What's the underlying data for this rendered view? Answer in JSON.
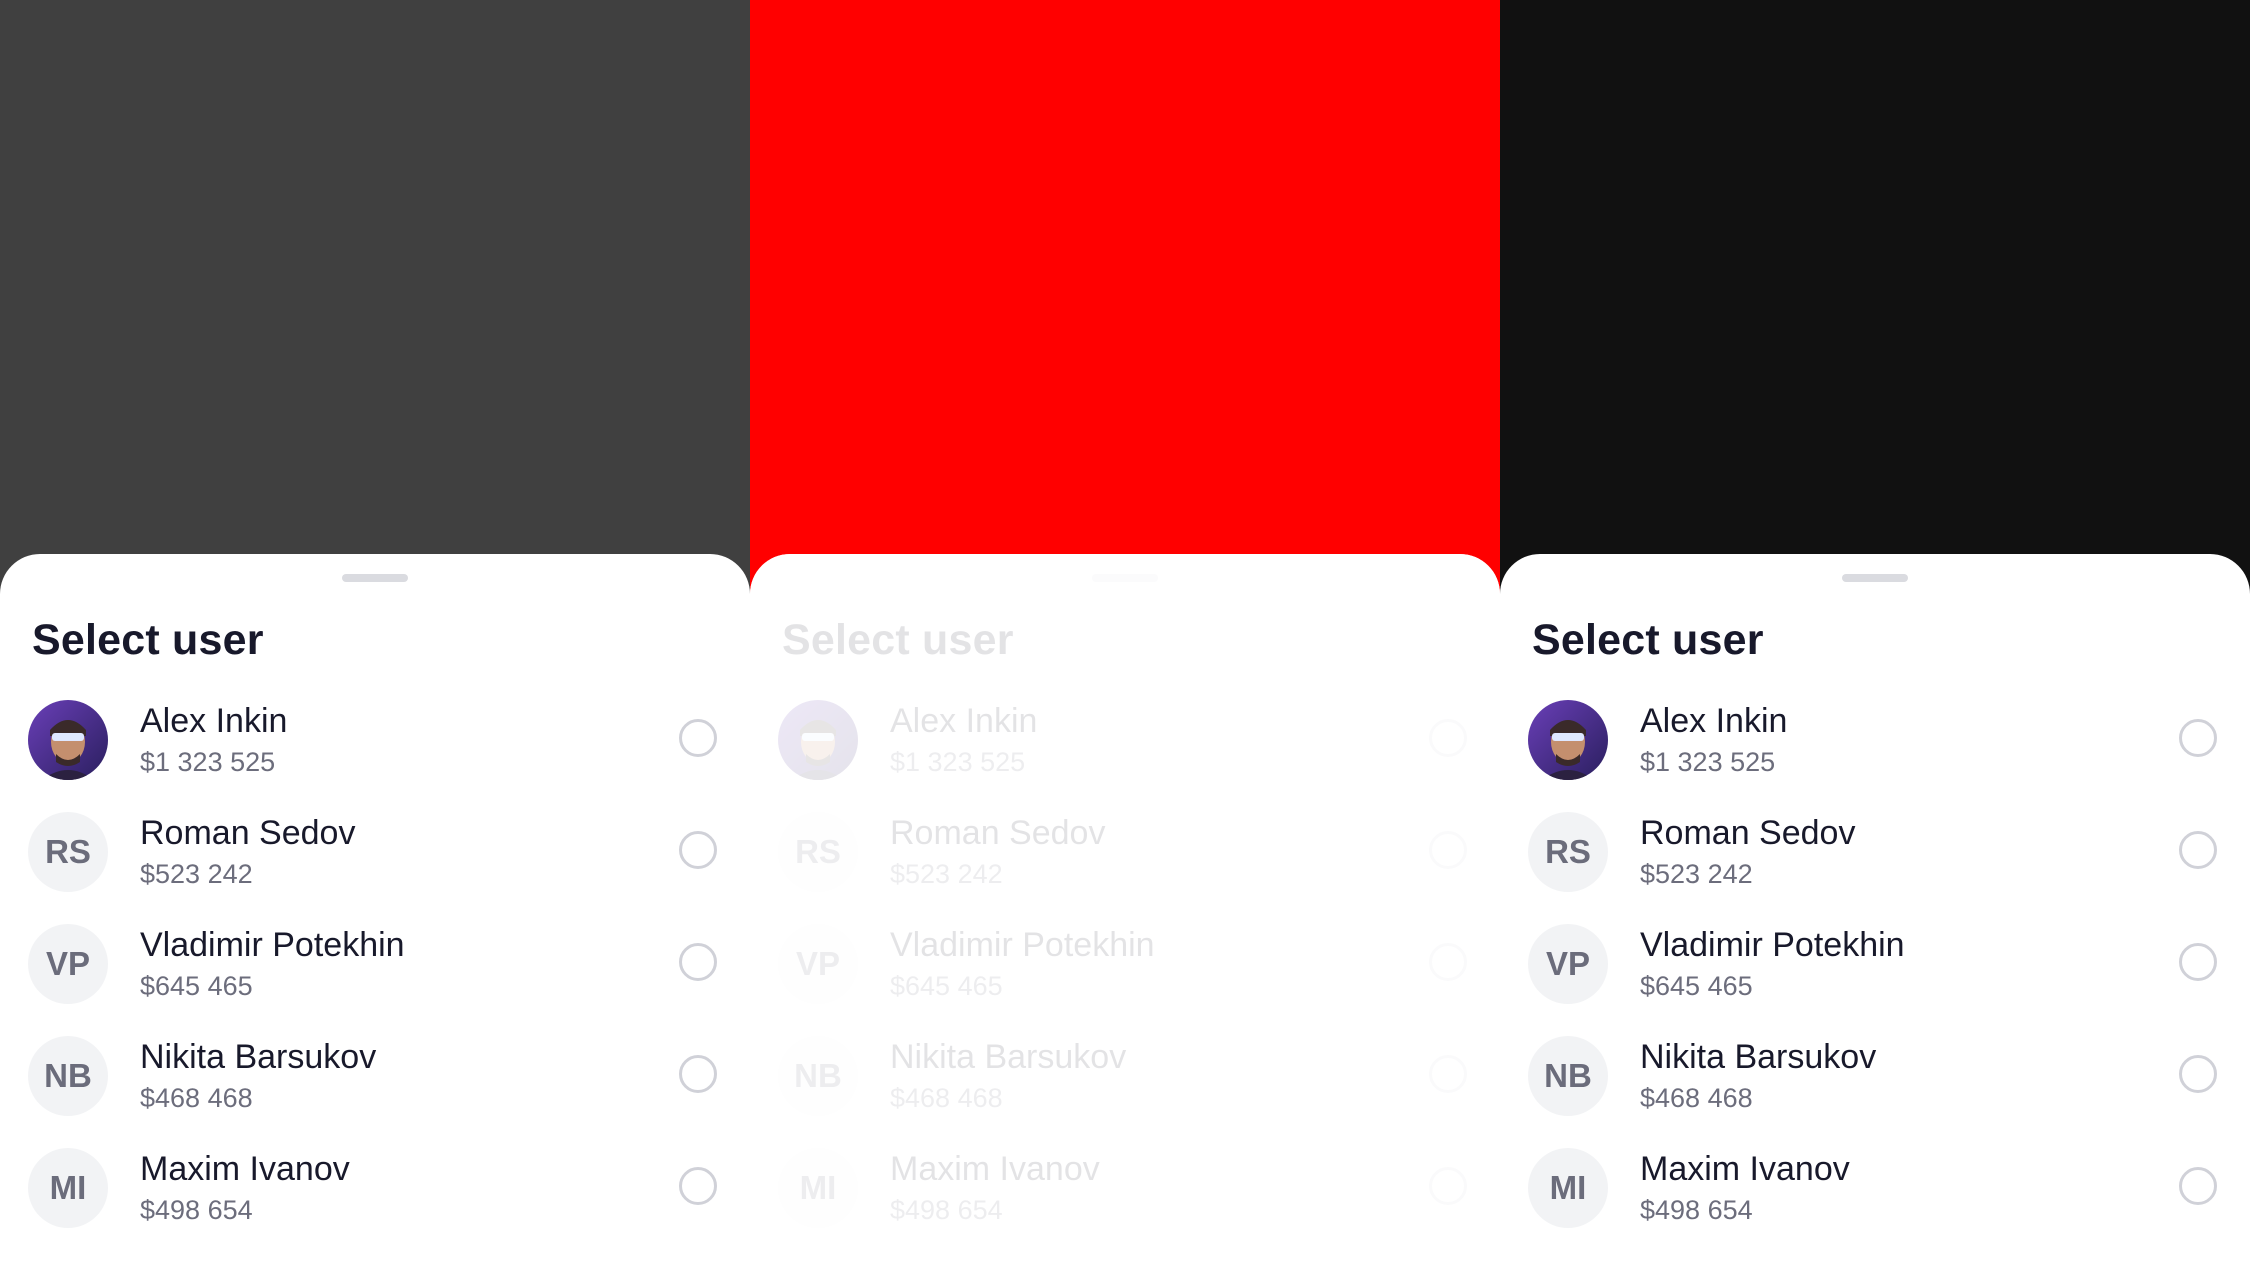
{
  "colors": {
    "panel_backdrops": [
      "#404040",
      "#ff0000",
      "#111111"
    ],
    "sheet_background": "#ffffff",
    "title_text": "#18192b",
    "secondary_text": "#6c6d7c",
    "initials_background": "#f2f3f5"
  },
  "panels": [
    {
      "state": "default",
      "title": "Select user",
      "users": [
        {
          "name": "Alex Inkin",
          "balance": "$1 323 525",
          "initials": "",
          "avatar": "photo-avatar",
          "selected": false
        },
        {
          "name": "Roman Sedov",
          "balance": "$523 242",
          "initials": "RS",
          "avatar": "initials",
          "selected": false
        },
        {
          "name": "Vladimir Potekhin",
          "balance": "$645 465",
          "initials": "VP",
          "avatar": "initials",
          "selected": false
        },
        {
          "name": "Nikita Barsukov",
          "balance": "$468 468",
          "initials": "NB",
          "avatar": "initials",
          "selected": false
        },
        {
          "name": "Maxim Ivanov",
          "balance": "$498 654",
          "initials": "MI",
          "avatar": "initials",
          "selected": false
        }
      ]
    },
    {
      "state": "faded",
      "title": "Select user",
      "users": [
        {
          "name": "Alex Inkin",
          "balance": "$1 323 525",
          "initials": "",
          "avatar": "photo-avatar",
          "selected": false
        },
        {
          "name": "Roman Sedov",
          "balance": "$523 242",
          "initials": "RS",
          "avatar": "initials",
          "selected": false
        },
        {
          "name": "Vladimir Potekhin",
          "balance": "$645 465",
          "initials": "VP",
          "avatar": "initials",
          "selected": false
        },
        {
          "name": "Nikita Barsukov",
          "balance": "$468 468",
          "initials": "NB",
          "avatar": "initials",
          "selected": false
        },
        {
          "name": "Maxim Ivanov",
          "balance": "$498 654",
          "initials": "MI",
          "avatar": "initials",
          "selected": false
        }
      ]
    },
    {
      "state": "default",
      "title": "Select user",
      "users": [
        {
          "name": "Alex Inkin",
          "balance": "$1 323 525",
          "initials": "",
          "avatar": "photo-avatar",
          "selected": false
        },
        {
          "name": "Roman Sedov",
          "balance": "$523 242",
          "initials": "RS",
          "avatar": "initials",
          "selected": false
        },
        {
          "name": "Vladimir Potekhin",
          "balance": "$645 465",
          "initials": "VP",
          "avatar": "initials",
          "selected": false
        },
        {
          "name": "Nikita Barsukov",
          "balance": "$468 468",
          "initials": "NB",
          "avatar": "initials",
          "selected": false
        },
        {
          "name": "Maxim Ivanov",
          "balance": "$498 654",
          "initials": "MI",
          "avatar": "initials",
          "selected": false
        }
      ]
    }
  ]
}
